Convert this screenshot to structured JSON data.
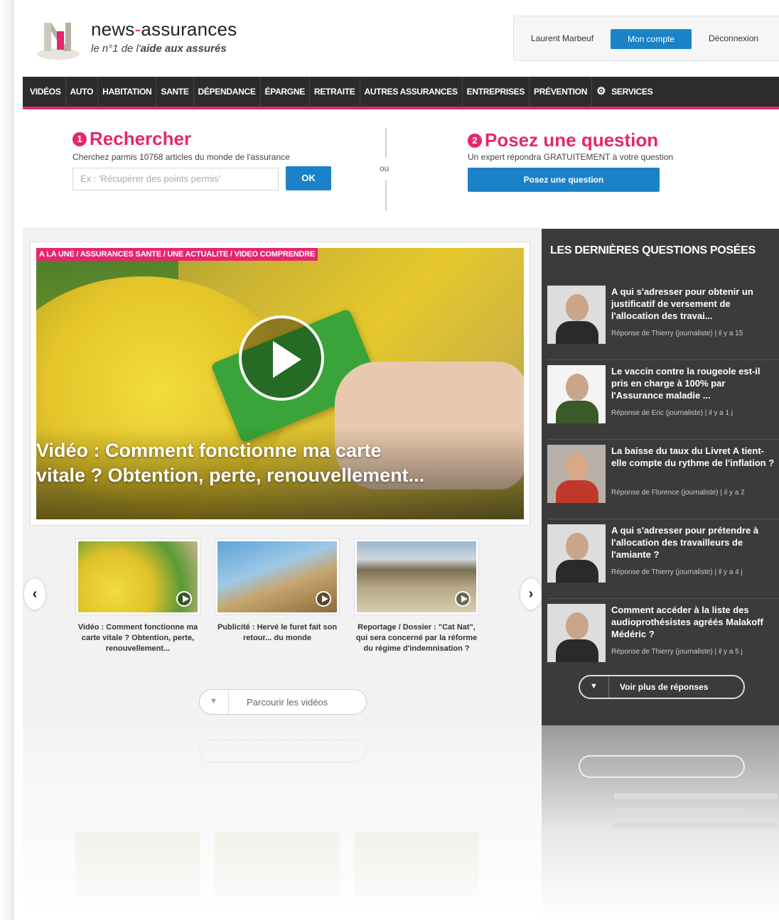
{
  "header": {
    "brand_prefix": "news",
    "brand_dash": "-",
    "brand_suffix": "assurances",
    "tagline_pre": "le n°1 de l'",
    "tagline_bold": "aide aux assurés",
    "user_name": "Laurent Marbeuf",
    "account_label": "Mon compte",
    "logout_label": "Déconnexion"
  },
  "nav": {
    "items": [
      "VIDÉOS",
      "AUTO",
      "HABITATION",
      "SANTE",
      "DÉPENDANCE",
      "ÉPARGNE",
      "RETRAITE",
      "AUTRES ASSURANCES",
      "ENTREPRISES",
      "PRÉVENTION"
    ],
    "services_label": "SERVICES"
  },
  "search": {
    "num": "1",
    "title": "Rechercher",
    "subtitle": "Cherchez parmis 10768 articles du monde de l'assurance",
    "placeholder": "Ex : 'Récupérer des points permis'",
    "ok_label": "OK",
    "or_label": "ou"
  },
  "ask": {
    "num": "2",
    "title": "Posez une question",
    "subtitle": "Un expert répondra GRATUITEMENT à votre question",
    "button_label": "Posez une question"
  },
  "featured": {
    "breadcrumb": "A LA UNE / ASSURANCES SANTE / UNE ACTUALITE / VIDEO COMPRENDRE",
    "title_line1": "Vidéo : Comment fonctionne ma carte",
    "title_line2": "vitale ? Obtention, perte, renouvellement..."
  },
  "thumbnails": [
    {
      "caption": "Vidéo : Comment fonctionne ma carte vitale ? Obtention, perte, renouvellement..."
    },
    {
      "caption": "Publicité : Hervé le furet fait son retour... du monde"
    },
    {
      "caption": "Reportage / Dossier : \"Cat Nat\", qui sera concerné par la réforme du régime d'indemnisation ?"
    }
  ],
  "browse_label": "Parcourir les vidéos",
  "sidebar": {
    "heading": "LES DERNIÈRES QUESTIONS POSÉES",
    "questions": [
      {
        "title": "A qui s'adresser pour obtenir un justificatif de versement de l'allocation des travai...",
        "meta": "Réponse de Thierry (journaliste) | il y a 15"
      },
      {
        "title": "Le vaccin contre la rougeole est-il pris en charge à 100% par l'Assurance maladie ...",
        "meta": "Réponse de Eric (journaliste) | il y a 1 j"
      },
      {
        "title": "La baisse du taux du Livret A tient-elle compte du rythme de l'inflation ?",
        "meta": "Réponse de Florence (journaliste) | il y a 2"
      },
      {
        "title": "A qui s'adresser pour prétendre à l'allocation des travailleurs de l'amiante ?",
        "meta": "Réponse de Thierry (journaliste) | il y a 4 j"
      },
      {
        "title": "Comment accéder à la liste des audioprothésistes agréés Malakoff Médéric ?",
        "meta": "Réponse de Thierry (journaliste) | il y a 5 j"
      }
    ],
    "more_label": "Voir plus de réponses"
  },
  "colors": {
    "accent": "#e5266e",
    "button": "#1b82c8",
    "nav": "#2c2c2c",
    "sidebar": "#3b3b3b"
  },
  "icons": [
    "play-icon",
    "gear-icon",
    "chevron-left-icon",
    "chevron-right-icon",
    "caret-down-icon"
  ]
}
